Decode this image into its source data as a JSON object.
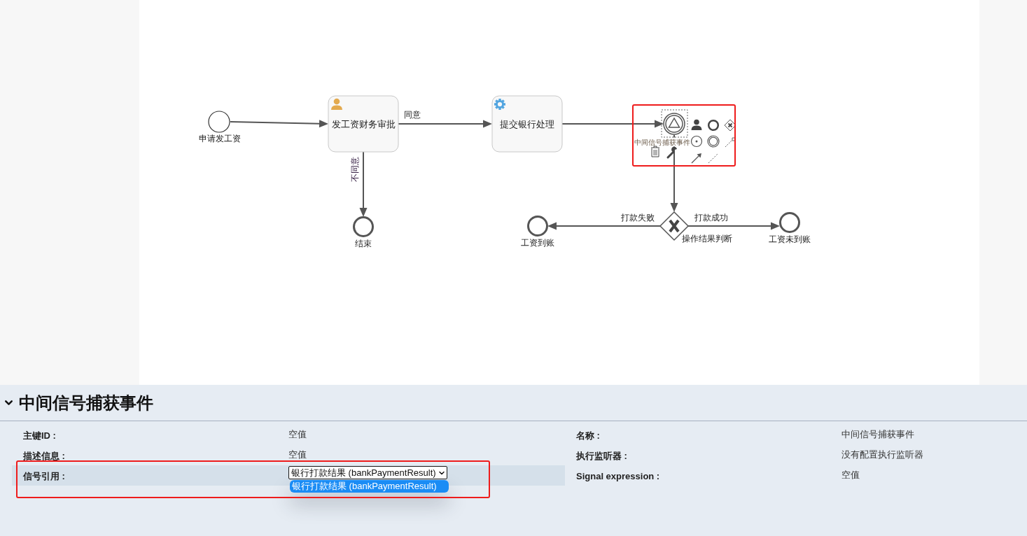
{
  "diagram": {
    "nodes": [
      {
        "kind": "start_event",
        "label": "申请发工资",
        "selected": false
      },
      {
        "kind": "user_task",
        "label": "发工资财务审批",
        "selected": false
      },
      {
        "kind": "service_task",
        "label": "提交银行处理",
        "selected": false
      },
      {
        "kind": "signal_catch_event",
        "label": "中间信号捕获事件",
        "selected": true
      },
      {
        "kind": "end_event",
        "label": "结束",
        "selected": false
      },
      {
        "kind": "end_event",
        "label": "工资到账",
        "selected": false
      },
      {
        "kind": "exclusive_gateway",
        "label": "操作结果判断",
        "selected": false
      },
      {
        "kind": "end_event",
        "label": "工资未到账",
        "selected": false
      }
    ],
    "flows": [
      {
        "label": "同意"
      },
      {
        "label": "不同意"
      },
      {
        "label": "打款失败"
      },
      {
        "label": "打款成功"
      }
    ]
  },
  "properties": {
    "title": "中间信号捕获事件",
    "expanded": true,
    "fields": [
      {
        "kind": "text",
        "label": "主键ID :",
        "value": "空值",
        "selected": false
      },
      {
        "kind": "text",
        "label": "名称 :",
        "value": "中间信号捕获事件",
        "selected": false
      },
      {
        "kind": "text",
        "label": "描述信息 :",
        "value": "空值",
        "selected": false
      },
      {
        "kind": "text",
        "label": "执行监听器 :",
        "value": "没有配置执行监听器",
        "selected": false
      },
      {
        "kind": "select",
        "label": "信号引用 :",
        "value": "银行打款结果 (bankPaymentResult)",
        "expanded": true,
        "options": [
          {
            "label": "银行打款结果 (bankPaymentResult)",
            "selected": true
          }
        ],
        "selected": true
      },
      {
        "kind": "text",
        "label": "Signal expression :",
        "value": "空值",
        "selected": false
      }
    ]
  }
}
